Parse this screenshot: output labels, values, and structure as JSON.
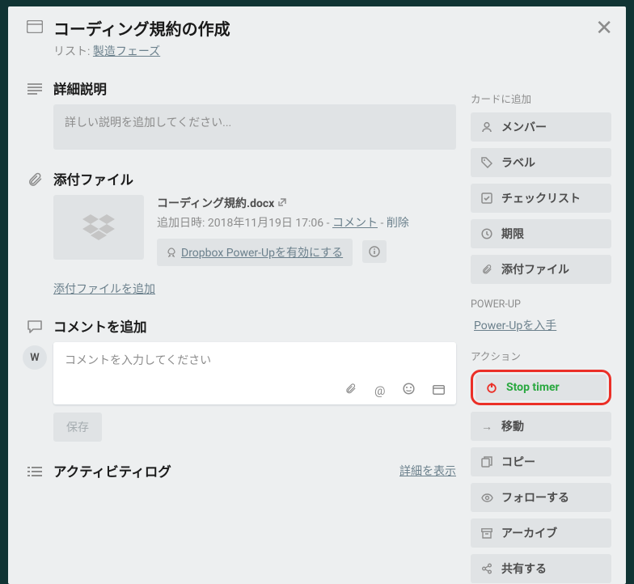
{
  "title": "コーディング規約の作成",
  "list_prefix": "リスト: ",
  "list_name": "製造フェーズ",
  "sections": {
    "description": "詳細説明",
    "attachments": "添付ファイル",
    "comment": "コメントを追加",
    "activity": "アクティビティログ"
  },
  "description_placeholder": "詳しい説明を追加してください...",
  "attachment": {
    "name": "コーディング規約.docx",
    "added_prefix": "追加日時: ",
    "added_time": "2018年11月19日 17:06",
    "sep": " - ",
    "comment_link": "コメント",
    "delete_link": "削除",
    "enable_dropbox": "Dropbox Power-Upを有効にする",
    "add_more": "添付ファイルを追加"
  },
  "comment": {
    "avatar_initial": "W",
    "placeholder": "コメントを入力してください",
    "save": "保存"
  },
  "activity_details": "詳細を表示",
  "sidebar": {
    "add_to_card": "カードに追加",
    "members": "メンバー",
    "labels": "ラベル",
    "checklist": "チェックリスト",
    "due": "期限",
    "attach": "添付ファイル",
    "powerup_head": "POWER-UP",
    "get_powerup": "Power-Upを入手",
    "actions_head": "アクション",
    "stop_timer": "Stop timer",
    "move": "移動",
    "copy": "コピー",
    "follow": "フォローする",
    "archive": "アーカイブ",
    "share": "共有する"
  }
}
